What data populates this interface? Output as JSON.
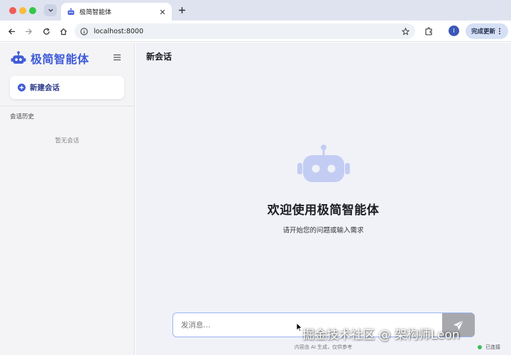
{
  "browser": {
    "tab_title": "极简智能体",
    "url": "localhost:8000",
    "profile_initial": "I",
    "update_label": "完成更新"
  },
  "sidebar": {
    "brand_name": "极简智能体",
    "new_chat_label": "新建会话",
    "history_title": "会话历史",
    "history_empty": "暂无会话"
  },
  "main": {
    "title": "新会话",
    "welcome_title": "欢迎使用极简智能体",
    "welcome_subtitle": "请开始您的问题或输入需求",
    "composer_placeholder": "发消息...",
    "disclaimer": "内容由 AI 生成，仅供参考",
    "status_label": "已连接"
  },
  "colors": {
    "brand": "#3f5bd8",
    "status_ok": "#3ebc5b",
    "send_button": "#a6a8ad"
  },
  "icons": [
    "robot-icon",
    "menu-icon",
    "plus-circle-icon",
    "send-icon",
    "star-icon",
    "extension-icon",
    "back-arrow-icon",
    "forward-arrow-icon",
    "reload-icon",
    "home-icon",
    "info-icon"
  ],
  "watermark": "掘金技术社区 @ 架构师Leon"
}
